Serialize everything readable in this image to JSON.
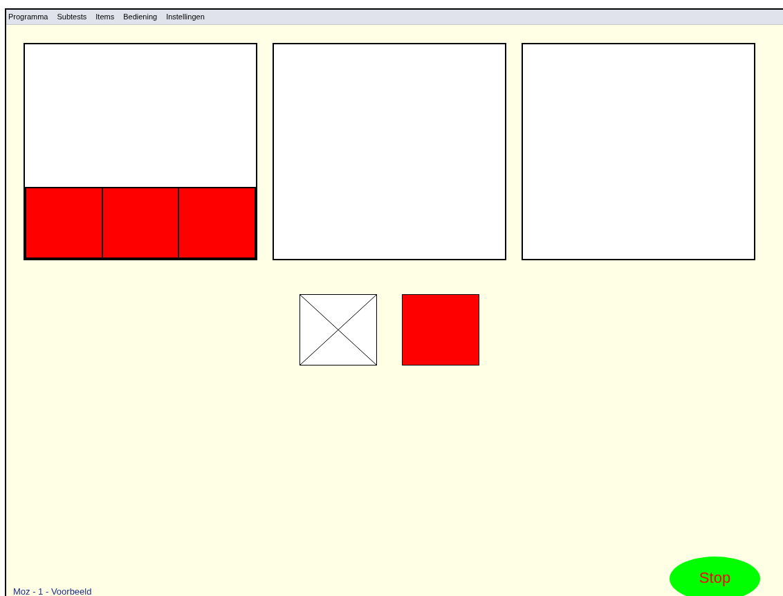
{
  "menu": [
    "Programma",
    "Subtests",
    "Items",
    "Bediening",
    "Instellingen"
  ],
  "panels": [
    {
      "kind": "tiles",
      "tiles": [
        {
          "color": "#ff0000"
        },
        {
          "color": "#ff0000"
        },
        {
          "color": "#ff0000"
        }
      ]
    },
    {
      "kind": "empty"
    },
    {
      "kind": "empty"
    }
  ],
  "choices": [
    {
      "kind": "blank"
    },
    {
      "kind": "swatch",
      "color": "#ff0000"
    }
  ],
  "stop_button": {
    "label": "Stop"
  },
  "status": "Moz - 1 - Voorbeeld"
}
